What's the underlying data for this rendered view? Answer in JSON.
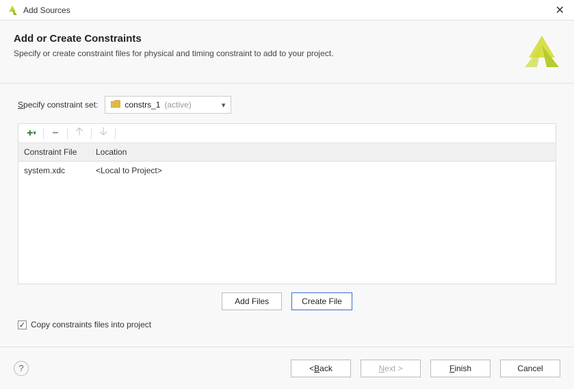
{
  "window": {
    "title": "Add Sources"
  },
  "header": {
    "title": "Add or Create Constraints",
    "subtitle": "Specify or create constraint files for physical and timing constraint to add to your project."
  },
  "constraint_set": {
    "label": "Specify constraint set:",
    "selected": "constrs_1",
    "note": "(active)"
  },
  "table": {
    "columns": {
      "file": "Constraint File",
      "location": "Location"
    },
    "rows": [
      {
        "file": "system.xdc",
        "location": "<Local to Project>"
      }
    ]
  },
  "file_buttons": {
    "add": "Add Files",
    "create": "Create File"
  },
  "copy_checkbox": {
    "checked": true,
    "label": "Copy constraints files into project"
  },
  "footer": {
    "back": "< Back",
    "next": "Next >",
    "finish_prefix": "F",
    "finish_suffix": "inish",
    "cancel": "Cancel"
  }
}
